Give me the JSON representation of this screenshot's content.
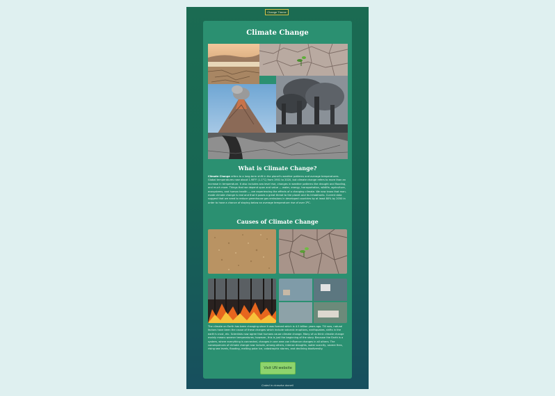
{
  "theme_button": {
    "label": "Change Theme"
  },
  "article": {
    "title": "Climate Change",
    "section1_title": "What is Climate Change?",
    "section1_lead": "Climate Change",
    "section1_text": " refers to a long-term shift in the planet's weather patterns and average temperatures. Global temperatures rose about 1.98°F (1.1°C) from 1901 to 2020, but climate change refers to more than an increase in temperature. It also includes sea level rise, changes in weather patterns like drought and flooding, and much more. Things that we depend upon and value — water, energy, transportation, wildlife, agriculture, ecosystems, and human health — are experiencing the effects of a changing climate. We now know that man-made climate change is real and that it poses a great threat to the planet and its inhabitants. Current data suggest that we need to reduce greenhouse gas emissions in developed countries by at least 80% by 2050 in order to have a chance of staying below an average temperature rise of over 2ºC.",
    "section2_title": "Causes of Climate Change",
    "section2_text": "The climate on Earth has been changing since it was formed which is 4.5 billion years ago. Till now, natural factors have been the cause of these changes which include volcanic eruptions, earthquakes, shifts in the earth's crust, etc. Scientists now agree that humans cause climate change. Many of us think climate change mainly means warmer temperatures; however, this is just the beginning of the story. Because the Earth is a system, where everything is connected, changes in one area can influence changes in all others. The consequences of climate change now include, among others, intense droughts, water scarcity, severe fires, rising sea levels, flooding, melting polar ice, catastrophic storms, and declining biodiversity.",
    "cta_label": "Visit UN website"
  },
  "footer": {
    "text": "Coded in ciranzha domeil"
  }
}
